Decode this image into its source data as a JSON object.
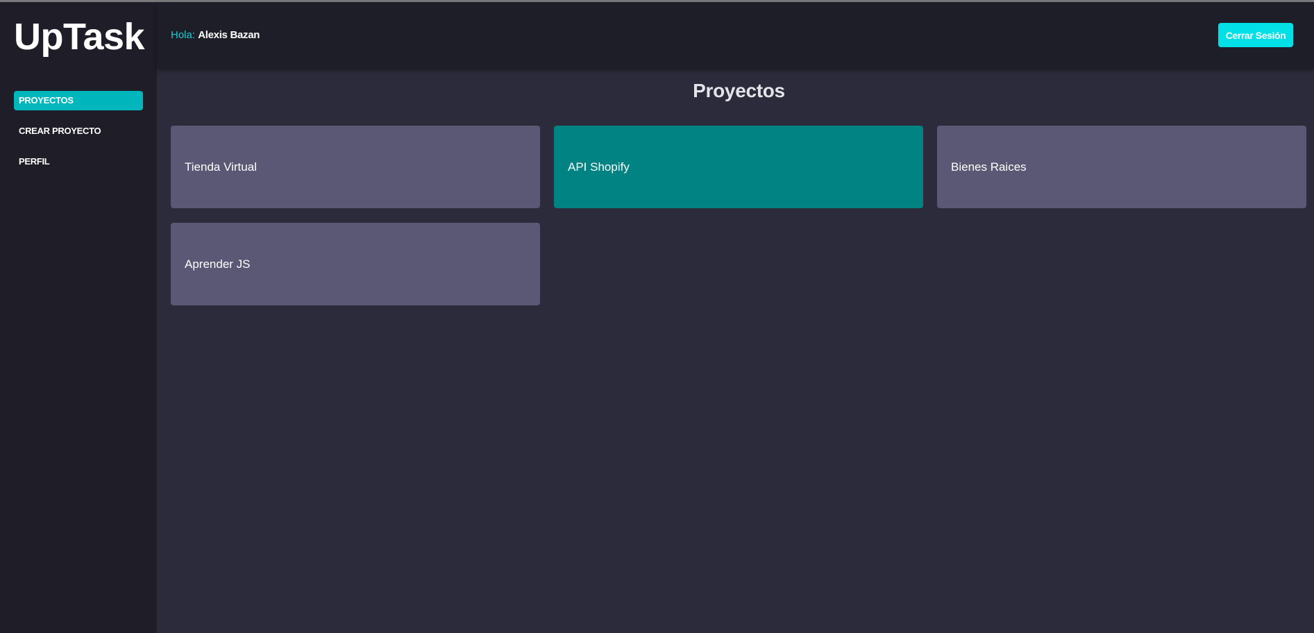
{
  "app": {
    "logo": "UpTask"
  },
  "sidebar": {
    "items": [
      {
        "label": "PROYECTOS",
        "active": true
      },
      {
        "label": "CREAR PROYECTO",
        "active": false
      },
      {
        "label": "PERFIL",
        "active": false
      }
    ]
  },
  "header": {
    "greeting_prefix": "Hola:",
    "user_name": "Alexis Bazan",
    "logout_label": "Cerrar Sesión"
  },
  "main": {
    "title": "Proyectos",
    "projects": [
      {
        "name": "Tienda Virtual",
        "highlighted": false
      },
      {
        "name": "API Shopify",
        "highlighted": true
      },
      {
        "name": "Bienes Raices",
        "highlighted": false
      },
      {
        "name": "Aprender JS",
        "highlighted": false
      }
    ]
  },
  "colors": {
    "accent": "#00b6bd",
    "button": "#00e0e6",
    "card": "#5a5874",
    "card_highlight": "#018383",
    "sidebar_bg": "#1f1e28",
    "main_bg": "#2c2b3b"
  }
}
